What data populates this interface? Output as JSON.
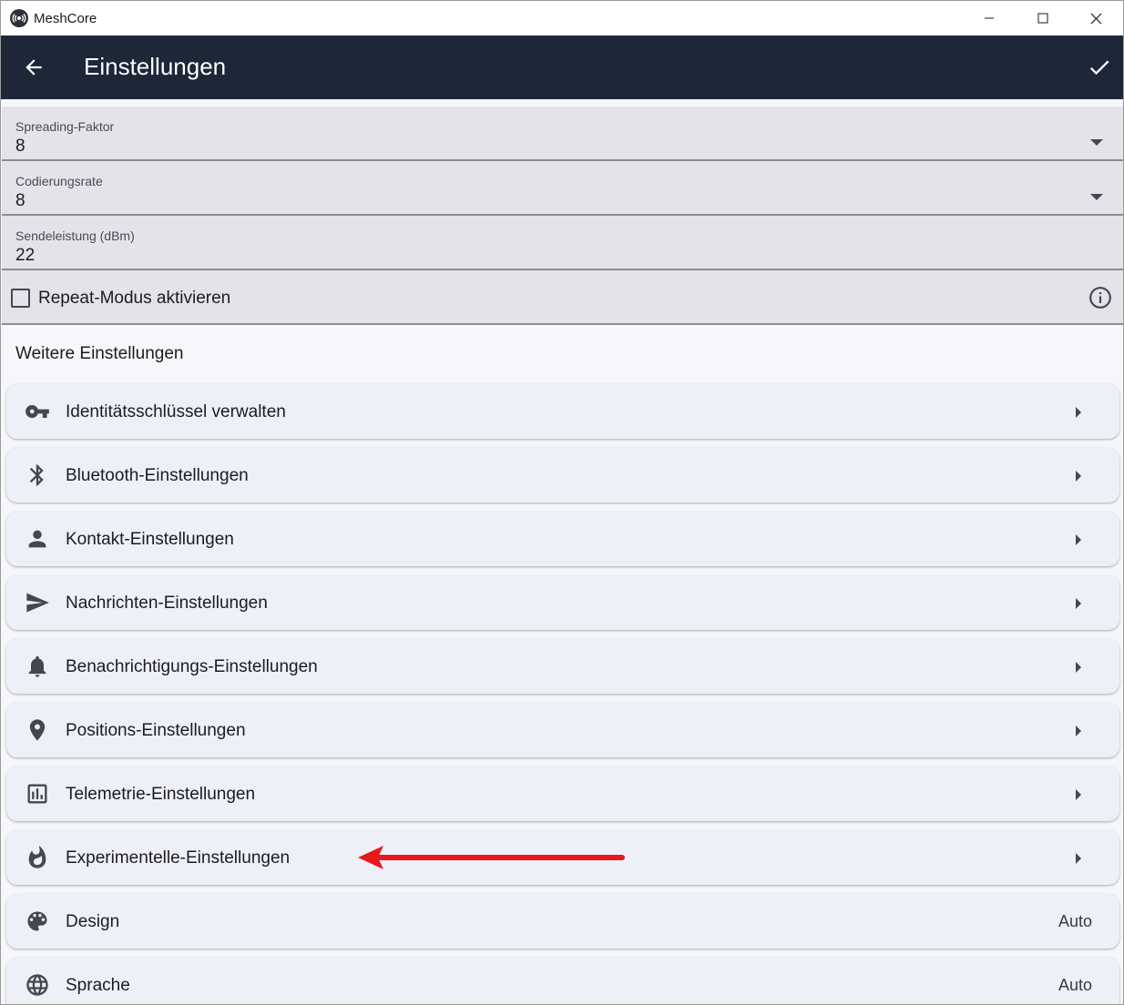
{
  "window": {
    "app_title": "MeshCore",
    "controls": {
      "minimize_icon": "minimize-icon",
      "maximize_icon": "maximize-icon",
      "close_icon": "close-icon"
    }
  },
  "appbar": {
    "title": "Einstellungen",
    "back_icon": "arrow-back-icon",
    "confirm_icon": "check-icon",
    "background": "#1e2738"
  },
  "fields": [
    {
      "label": "Spreading-Faktor",
      "value": "8",
      "type": "dropdown"
    },
    {
      "label": "Codierungsrate",
      "value": "8",
      "type": "dropdown"
    },
    {
      "label": "Sendeleistung (dBm)",
      "value": "22",
      "type": "text"
    }
  ],
  "repeat": {
    "label": "Repeat-Modus aktivieren",
    "checked": false,
    "info_icon": "info-icon"
  },
  "section": {
    "title": "Weitere Einstellungen"
  },
  "items": [
    {
      "label": "Identitätsschlüssel verwalten",
      "icon": "key-icon",
      "trailing": ""
    },
    {
      "label": "Bluetooth-Einstellungen",
      "icon": "bluetooth-icon",
      "trailing": ""
    },
    {
      "label": "Kontakt-Einstellungen",
      "icon": "person-icon",
      "trailing": ""
    },
    {
      "label": "Nachrichten-Einstellungen",
      "icon": "send-icon",
      "trailing": ""
    },
    {
      "label": "Benachrichtigungs-Einstellungen",
      "icon": "bell-icon",
      "trailing": ""
    },
    {
      "label": "Positions-Einstellungen",
      "icon": "location-pin-icon",
      "trailing": ""
    },
    {
      "label": "Telemetrie-Einstellungen",
      "icon": "chart-icon",
      "trailing": ""
    },
    {
      "label": "Experimentelle-Einstellungen",
      "icon": "flame-icon",
      "trailing": ""
    },
    {
      "label": "Design",
      "icon": "palette-icon",
      "trailing": "Auto"
    },
    {
      "label": "Sprache",
      "icon": "globe-icon",
      "trailing": "Auto"
    }
  ],
  "annotation": {
    "arrow_color": "#e8191e"
  }
}
